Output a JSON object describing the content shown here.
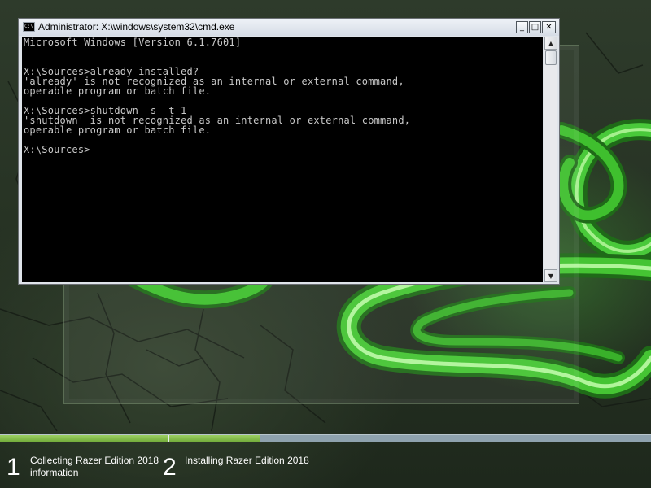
{
  "window": {
    "title": "Administrator: X:\\windows\\system32\\cmd.exe",
    "icon": "cmd-icon",
    "icon_glyph": "C:\\",
    "buttons": {
      "minimize": "_",
      "maximize": "□",
      "close": "✕"
    }
  },
  "console": {
    "lines": [
      "Microsoft Windows [Version 6.1.7601]",
      "",
      "",
      "X:\\Sources>already installed?",
      "'already' is not recognized as an internal or external command,",
      "operable program or batch file.",
      "",
      "X:\\Sources>shutdown -s -t 1",
      "'shutdown' is not recognized as an internal or external command,",
      "operable program or batch file.",
      "",
      "X:\\Sources>"
    ]
  },
  "scrollbar": {
    "up": "▲",
    "down": "▼"
  },
  "setup": {
    "progress_fraction": 0.4,
    "steps": [
      {
        "number": "1",
        "label": "Collecting Razer Edition 2018 information"
      },
      {
        "number": "2",
        "label": "Installing Razer Edition 2018"
      }
    ]
  },
  "colors": {
    "console_bg": "#000000",
    "console_text": "#c8c8c8",
    "progress_fill": "#8cc152",
    "accent_green": "#3fbf2e"
  }
}
